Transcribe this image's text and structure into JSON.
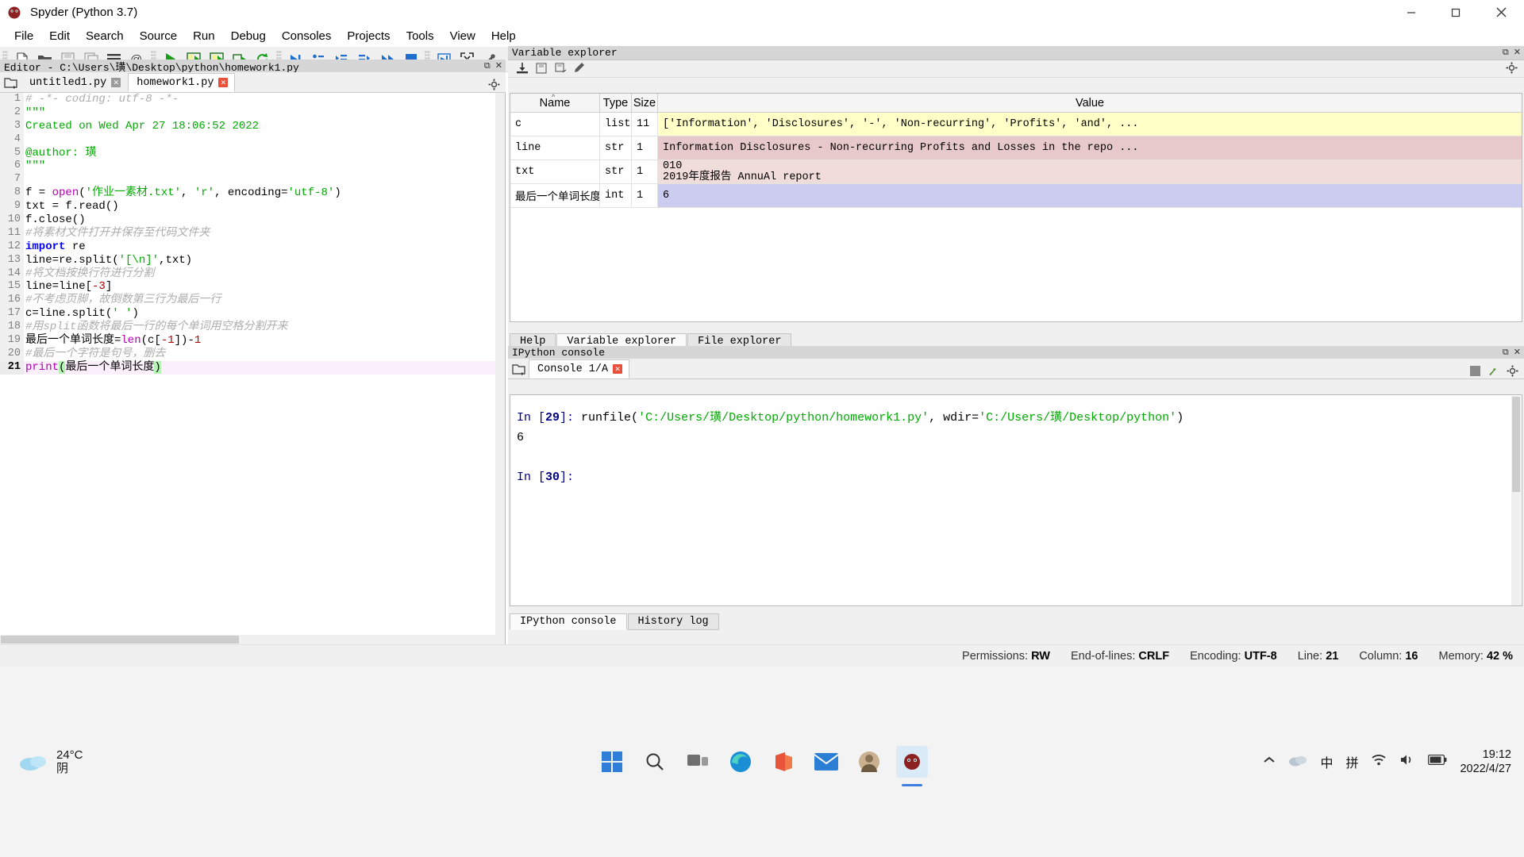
{
  "window": {
    "title": "Spyder (Python 3.7)",
    "app_icon": "spyder-logo-icon",
    "minimize": "minimize-icon",
    "maximize": "maximize-icon",
    "close": "close-icon"
  },
  "menubar": {
    "items": [
      "File",
      "Edit",
      "Search",
      "Source",
      "Run",
      "Debug",
      "Consoles",
      "Projects",
      "Tools",
      "View",
      "Help"
    ]
  },
  "toolbar": {
    "path_value": "C:\\Users\\璜\\Desktop\\python",
    "buttons": [
      "new-file-icon",
      "open-file-icon",
      "save-file-icon",
      "save-all-icon",
      "file-list-icon",
      "find-in-files-icon",
      "run-file-icon",
      "run-cell-icon",
      "run-cell-advance-icon",
      "run-selection-icon",
      "re-run-icon",
      "debug-file-icon",
      "debug-step-icon",
      "debug-step-into-icon",
      "debug-step-return-icon",
      "debug-continue-icon",
      "debug-stop-icon",
      "maximize-pane-icon",
      "fullscreen-icon",
      "preferences-icon",
      "pythonpath-icon",
      "back-icon",
      "forward-icon",
      "browse-folder-icon",
      "parent-folder-icon"
    ]
  },
  "editor": {
    "panel_title": "Editor - C:\\Users\\璜\\Desktop\\python\\homework1.py",
    "browse_tabs_icon": "browse-tabs-icon",
    "options_icon": "options-gear-icon",
    "tabs": [
      {
        "label": "untitled1.py",
        "close": "close-tab-icon",
        "modified": false,
        "active": false
      },
      {
        "label": "homework1.py",
        "close": "close-tab-icon",
        "modified": true,
        "active": true
      }
    ],
    "lines": [
      {
        "n": "1",
        "tokens": [
          {
            "t": "# -*- coding: utf-8 -*-",
            "c": "cm"
          }
        ]
      },
      {
        "n": "2",
        "tokens": [
          {
            "t": "\"\"\"",
            "c": "ds"
          }
        ]
      },
      {
        "n": "3",
        "tokens": [
          {
            "t": "Created on Wed Apr 27 18:06:52 2022",
            "c": "ds"
          }
        ]
      },
      {
        "n": "4",
        "tokens": []
      },
      {
        "n": "5",
        "tokens": [
          {
            "t": "@author: 璜",
            "c": "ds"
          }
        ]
      },
      {
        "n": "6",
        "tokens": [
          {
            "t": "\"\"\"",
            "c": "ds"
          }
        ]
      },
      {
        "n": "7",
        "tokens": []
      },
      {
        "n": "8",
        "tokens": [
          {
            "t": "f = ",
            "c": ""
          },
          {
            "t": "open",
            "c": "bi"
          },
          {
            "t": "(",
            "c": ""
          },
          {
            "t": "'作业一素材.txt'",
            "c": "str"
          },
          {
            "t": ", ",
            "c": ""
          },
          {
            "t": "'r'",
            "c": "str"
          },
          {
            "t": ", encoding=",
            "c": ""
          },
          {
            "t": "'utf-8'",
            "c": "str"
          },
          {
            "t": ")",
            "c": ""
          }
        ]
      },
      {
        "n": "9",
        "tokens": [
          {
            "t": "txt = f.read()",
            "c": ""
          }
        ]
      },
      {
        "n": "10",
        "tokens": [
          {
            "t": "f.close()",
            "c": ""
          }
        ]
      },
      {
        "n": "11",
        "tokens": [
          {
            "t": "#将素材文件打开并保存至代码文件夹",
            "c": "cm"
          }
        ]
      },
      {
        "n": "12",
        "tokens": [
          {
            "t": "import",
            "c": "kw"
          },
          {
            "t": " re",
            "c": ""
          }
        ]
      },
      {
        "n": "13",
        "tokens": [
          {
            "t": "line=re.split(",
            "c": ""
          },
          {
            "t": "'[\\n]'",
            "c": "str"
          },
          {
            "t": ",txt)",
            "c": ""
          }
        ]
      },
      {
        "n": "14",
        "tokens": [
          {
            "t": "#将文档按换行符进行分割",
            "c": "cm"
          }
        ]
      },
      {
        "n": "15",
        "tokens": [
          {
            "t": "line=line[",
            "c": ""
          },
          {
            "t": "-3",
            "c": "num"
          },
          {
            "t": "]",
            "c": ""
          }
        ]
      },
      {
        "n": "16",
        "tokens": [
          {
            "t": "#不考虑页脚，故倒数第三行为最后一行",
            "c": "cm"
          }
        ]
      },
      {
        "n": "17",
        "tokens": [
          {
            "t": "c=line.split(",
            "c": ""
          },
          {
            "t": "' '",
            "c": "str"
          },
          {
            "t": ")",
            "c": ""
          }
        ]
      },
      {
        "n": "18",
        "tokens": [
          {
            "t": "#用split函数将最后一行的每个单词用空格分割开来",
            "c": "cm"
          }
        ]
      },
      {
        "n": "19",
        "tokens": [
          {
            "t": "最后一个单词长度=",
            "c": ""
          },
          {
            "t": "len",
            "c": "bi"
          },
          {
            "t": "(c[",
            "c": ""
          },
          {
            "t": "-1",
            "c": "num"
          },
          {
            "t": "])-",
            "c": ""
          },
          {
            "t": "1",
            "c": "num"
          }
        ]
      },
      {
        "n": "20",
        "tokens": [
          {
            "t": "#最后一个字符是句号，删去",
            "c": "cm"
          }
        ]
      },
      {
        "n": "21",
        "tokens": [
          {
            "t": "print",
            "c": "bi"
          },
          {
            "t": "(",
            "c": "mbrace"
          },
          {
            "t": "最后一个单词长度",
            "c": ""
          },
          {
            "t": ")",
            "c": "mbrace"
          }
        ],
        "highlight": true
      }
    ]
  },
  "variable_explorer": {
    "panel_title": "Variable explorer",
    "toolbar_icons": [
      "import-data-icon",
      "save-data-icon",
      "save-as-icon",
      "reset-namespace-icon",
      "options-gear-icon"
    ],
    "columns": [
      "Name",
      "Type",
      "Size",
      "Value"
    ],
    "sort_indicator": "^",
    "rows": [
      {
        "name": "c",
        "type": "list",
        "size": "11",
        "value": "['Information', 'Disclosures', '-', 'Non-recurring', 'Profits', 'and', ...",
        "color": "yellow"
      },
      {
        "name": "line",
        "type": "str",
        "size": "1",
        "value": "Information Disclosures - Non-recurring Profits and Losses in the repo ...",
        "color": "pink"
      },
      {
        "name": "txt",
        "type": "str",
        "size": "1",
        "value": "010",
        "value2": "2019年度报告 AnnuAl report",
        "color": "pink2"
      },
      {
        "name": "最后一个单词长度",
        "type": "int",
        "size": "1",
        "value": "6",
        "color": "blue"
      }
    ],
    "bottom_tabs": [
      {
        "label": "Help",
        "active": false
      },
      {
        "label": "Variable explorer",
        "active": true
      },
      {
        "label": "File explorer",
        "active": false
      }
    ]
  },
  "console": {
    "panel_title": "IPython console",
    "browse_tabs_icon": "browse-tabs-icon",
    "tab": {
      "label": "Console 1/A",
      "close": "close-tab-icon"
    },
    "toolbar_icons": [
      "stop-icon",
      "connect-icon",
      "options-gear-icon"
    ],
    "lines": [
      {
        "prompt": "In [",
        "num": "29",
        "prompt_end": "]: ",
        "parts": [
          {
            "t": "runfile(",
            "c": ""
          },
          {
            "t": "'C:/Users/璜/Desktop/python/homework1.py'",
            "c": "green"
          },
          {
            "t": ", wdir=",
            "c": ""
          },
          {
            "t": "'C:/Users/璜/Desktop/python'",
            "c": "green"
          },
          {
            "t": ")",
            "c": ""
          }
        ]
      },
      {
        "output": "6"
      },
      {
        "blank": true
      },
      {
        "prompt": "In [",
        "num": "30",
        "prompt_end": "]: ",
        "parts": []
      }
    ],
    "bottom_tabs": [
      {
        "label": "IPython console",
        "active": true
      },
      {
        "label": "History log",
        "active": false
      }
    ]
  },
  "statusbar": {
    "items": [
      {
        "label": "Permissions:",
        "value": "RW"
      },
      {
        "label": "End-of-lines:",
        "value": "CRLF"
      },
      {
        "label": "Encoding:",
        "value": "UTF-8"
      },
      {
        "label": "Line:",
        "value": "21"
      },
      {
        "label": "Column:",
        "value": "16"
      },
      {
        "label": "Memory:",
        "value": "42 %"
      }
    ]
  },
  "taskbar": {
    "weather": {
      "icon": "cloudy-icon",
      "temp": "24°C",
      "condition": "阴"
    },
    "icons": [
      "start-icon",
      "search-icon",
      "task-view-icon",
      "edge-icon",
      "office-icon",
      "mail-icon",
      "user-photo-icon",
      "spyder-icon"
    ],
    "tray": {
      "chevron": "show-hidden-icons-icon",
      "cloud": "onedrive-icon",
      "ime_lang": "中",
      "ime_pinyin": "拼",
      "wifi": "wifi-icon",
      "volume": "volume-icon",
      "battery": "battery-icon"
    },
    "clock": {
      "time": "19:12",
      "date": "2022/4/27"
    }
  }
}
